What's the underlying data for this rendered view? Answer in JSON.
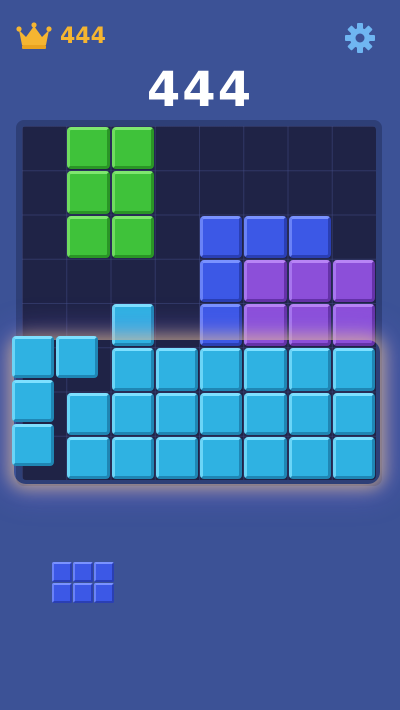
{
  "header": {
    "best_score": "444",
    "crown_icon": "crown-icon",
    "settings_icon": "gear-icon"
  },
  "score": "444",
  "colors": {
    "background": "#3c5296",
    "board": "#1f2346",
    "best_score": "#f5b531",
    "green": "#3fc23a",
    "blue": "#3c58e6",
    "purple": "#8c4fd9",
    "cyan": "#2fb2e2"
  },
  "board": {
    "columns": 8,
    "rows": 8,
    "filled_cells": [
      {
        "row": 0,
        "col": 1,
        "color": "green"
      },
      {
        "row": 0,
        "col": 2,
        "color": "green"
      },
      {
        "row": 1,
        "col": 1,
        "color": "green"
      },
      {
        "row": 1,
        "col": 2,
        "color": "green"
      },
      {
        "row": 2,
        "col": 1,
        "color": "green"
      },
      {
        "row": 2,
        "col": 2,
        "color": "green"
      },
      {
        "row": 2,
        "col": 4,
        "color": "blue"
      },
      {
        "row": 2,
        "col": 5,
        "color": "blue"
      },
      {
        "row": 2,
        "col": 6,
        "color": "blue"
      },
      {
        "row": 3,
        "col": 4,
        "color": "blue"
      },
      {
        "row": 3,
        "col": 5,
        "color": "purple"
      },
      {
        "row": 3,
        "col": 6,
        "color": "purple"
      },
      {
        "row": 3,
        "col": 7,
        "color": "purple"
      },
      {
        "row": 4,
        "col": 2,
        "color": "cyan"
      },
      {
        "row": 4,
        "col": 4,
        "color": "blue"
      },
      {
        "row": 4,
        "col": 5,
        "color": "purple"
      },
      {
        "row": 4,
        "col": 6,
        "color": "purple"
      },
      {
        "row": 4,
        "col": 7,
        "color": "purple"
      },
      {
        "row": 5,
        "col": 2,
        "color": "cyan"
      },
      {
        "row": 5,
        "col": 3,
        "color": "cyan"
      },
      {
        "row": 5,
        "col": 4,
        "color": "cyan"
      },
      {
        "row": 5,
        "col": 5,
        "color": "cyan"
      },
      {
        "row": 5,
        "col": 6,
        "color": "cyan"
      },
      {
        "row": 5,
        "col": 7,
        "color": "cyan"
      },
      {
        "row": 6,
        "col": 1,
        "color": "cyan"
      },
      {
        "row": 6,
        "col": 2,
        "color": "cyan"
      },
      {
        "row": 6,
        "col": 3,
        "color": "cyan"
      },
      {
        "row": 6,
        "col": 4,
        "color": "cyan"
      },
      {
        "row": 6,
        "col": 5,
        "color": "cyan"
      },
      {
        "row": 6,
        "col": 6,
        "color": "cyan"
      },
      {
        "row": 6,
        "col": 7,
        "color": "cyan"
      },
      {
        "row": 7,
        "col": 1,
        "color": "cyan"
      },
      {
        "row": 7,
        "col": 2,
        "color": "cyan"
      },
      {
        "row": 7,
        "col": 3,
        "color": "cyan"
      },
      {
        "row": 7,
        "col": 4,
        "color": "cyan"
      },
      {
        "row": 7,
        "col": 5,
        "color": "cyan"
      },
      {
        "row": 7,
        "col": 6,
        "color": "cyan"
      },
      {
        "row": 7,
        "col": 7,
        "color": "cyan"
      }
    ]
  },
  "dragging_piece": {
    "color": "cyan",
    "cells": [
      [
        0,
        0
      ],
      [
        0,
        1
      ],
      [
        1,
        0
      ],
      [
        2,
        0
      ]
    ]
  },
  "tray": {
    "pieces": [
      {
        "color": "blue",
        "rows": 2,
        "cols": 3
      }
    ]
  }
}
